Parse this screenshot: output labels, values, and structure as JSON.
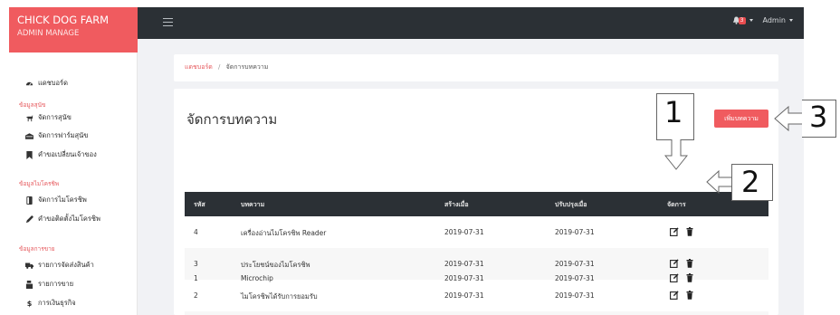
{
  "brand": {
    "title": "CHICK DOG FARM",
    "subtitle": "ADMIN MANAGE"
  },
  "sidebar": {
    "dashboard": {
      "label": "แดชบอร์ด",
      "icon": "dashboard-icon"
    },
    "sections": [
      {
        "heading": "ข้อมูลสุนัข",
        "items": [
          {
            "label": "จัดการสุนัข",
            "icon": "dog-icon"
          },
          {
            "label": "จัดการฟาร์มสุนัข",
            "icon": "kennel-icon"
          },
          {
            "label": "คำขอเปลี่ยนเจ้าของ",
            "icon": "bookmark-icon"
          }
        ]
      },
      {
        "heading": "ข้อมูลไมโครชิพ",
        "items": [
          {
            "label": "จัดการไมโครชิพ",
            "icon": "chip-icon"
          },
          {
            "label": "คำขอติดตั้งไมโครชิพ",
            "icon": "pen-icon"
          }
        ]
      },
      {
        "heading": "ข้อมูลการขาย",
        "items": [
          {
            "label": "รายการจัดส่งสินค้า",
            "icon": "truck-icon"
          },
          {
            "label": "รายการขาย",
            "icon": "register-icon"
          },
          {
            "label": "การเงินธุรกิจ",
            "icon": "dollar-icon"
          }
        ]
      }
    ]
  },
  "topbar": {
    "menu_icon": "hamburger-icon",
    "notification_count": "3",
    "user_label": "Admin"
  },
  "breadcrumb": {
    "home": "แดชบอร์ด",
    "separator": "/",
    "current": "จัดการบทความ"
  },
  "page": {
    "title": "จัดการบทความ",
    "add_button": "เพิ่มบทความ"
  },
  "table": {
    "columns": [
      "รหัส",
      "บทความ",
      "สร้างเมื่อ",
      "ปรับปรุงเมื่อ",
      "จัดการ"
    ],
    "rows": [
      {
        "id": "4",
        "title": "เครื่องอ่านไมโครชิพ Reader",
        "created": "2019-07-31",
        "updated": "2019-07-31"
      },
      {
        "id": "3",
        "title": "ประโยชน์ของไมโครชิพ",
        "created": "2019-07-31",
        "updated": "2019-07-31"
      },
      {
        "id": "2",
        "title": "ไมโครชิพได้รับการยอมรับ",
        "created": "2019-07-31",
        "updated": "2019-07-31"
      },
      {
        "id": "1",
        "title": "Microchip",
        "created": "2019-07-31",
        "updated": "2019-07-31"
      }
    ],
    "actions": {
      "edit_icon": "edit-icon",
      "delete_icon": "trash-icon"
    }
  },
  "annotations": [
    "1",
    "2",
    "3"
  ],
  "colors": {
    "brand": "#f05b5f",
    "topbar": "#2b3035",
    "table_head": "#2b3035",
    "page_bg": "#f1f2f5"
  }
}
